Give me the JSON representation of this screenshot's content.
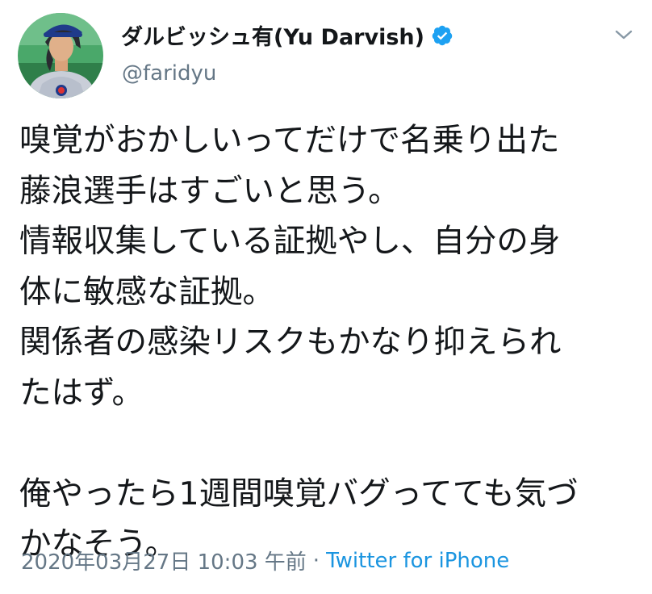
{
  "author": {
    "display_name": "ダルビッシュ有(Yu Darvish)",
    "handle": "@faridyu",
    "avatar_icon": "user-avatar-photo",
    "verified_icon": "verified-badge-icon",
    "verified_color": "#1da1f2"
  },
  "menu": {
    "icon": "chevron-down-icon"
  },
  "tweet": {
    "lines": [
      "嗅覚がおかしいってだけで名乗り出た",
      "藤浪選手はすごいと思う。",
      "情報収集している証拠やし、自分の身",
      "体に敏感な証拠。",
      "関係者の感染リスクもかなり抑えられ",
      "たはず。",
      "",
      "俺やったら1週間嗅覚バグってても気づ",
      "かなそう。"
    ],
    "timestamp": "2020年03月27日 10:03 午前",
    "separator": "·",
    "source": "Twitter for iPhone"
  },
  "colors": {
    "text": "#14171a",
    "secondary": "#657786",
    "link": "#1b95e0"
  }
}
